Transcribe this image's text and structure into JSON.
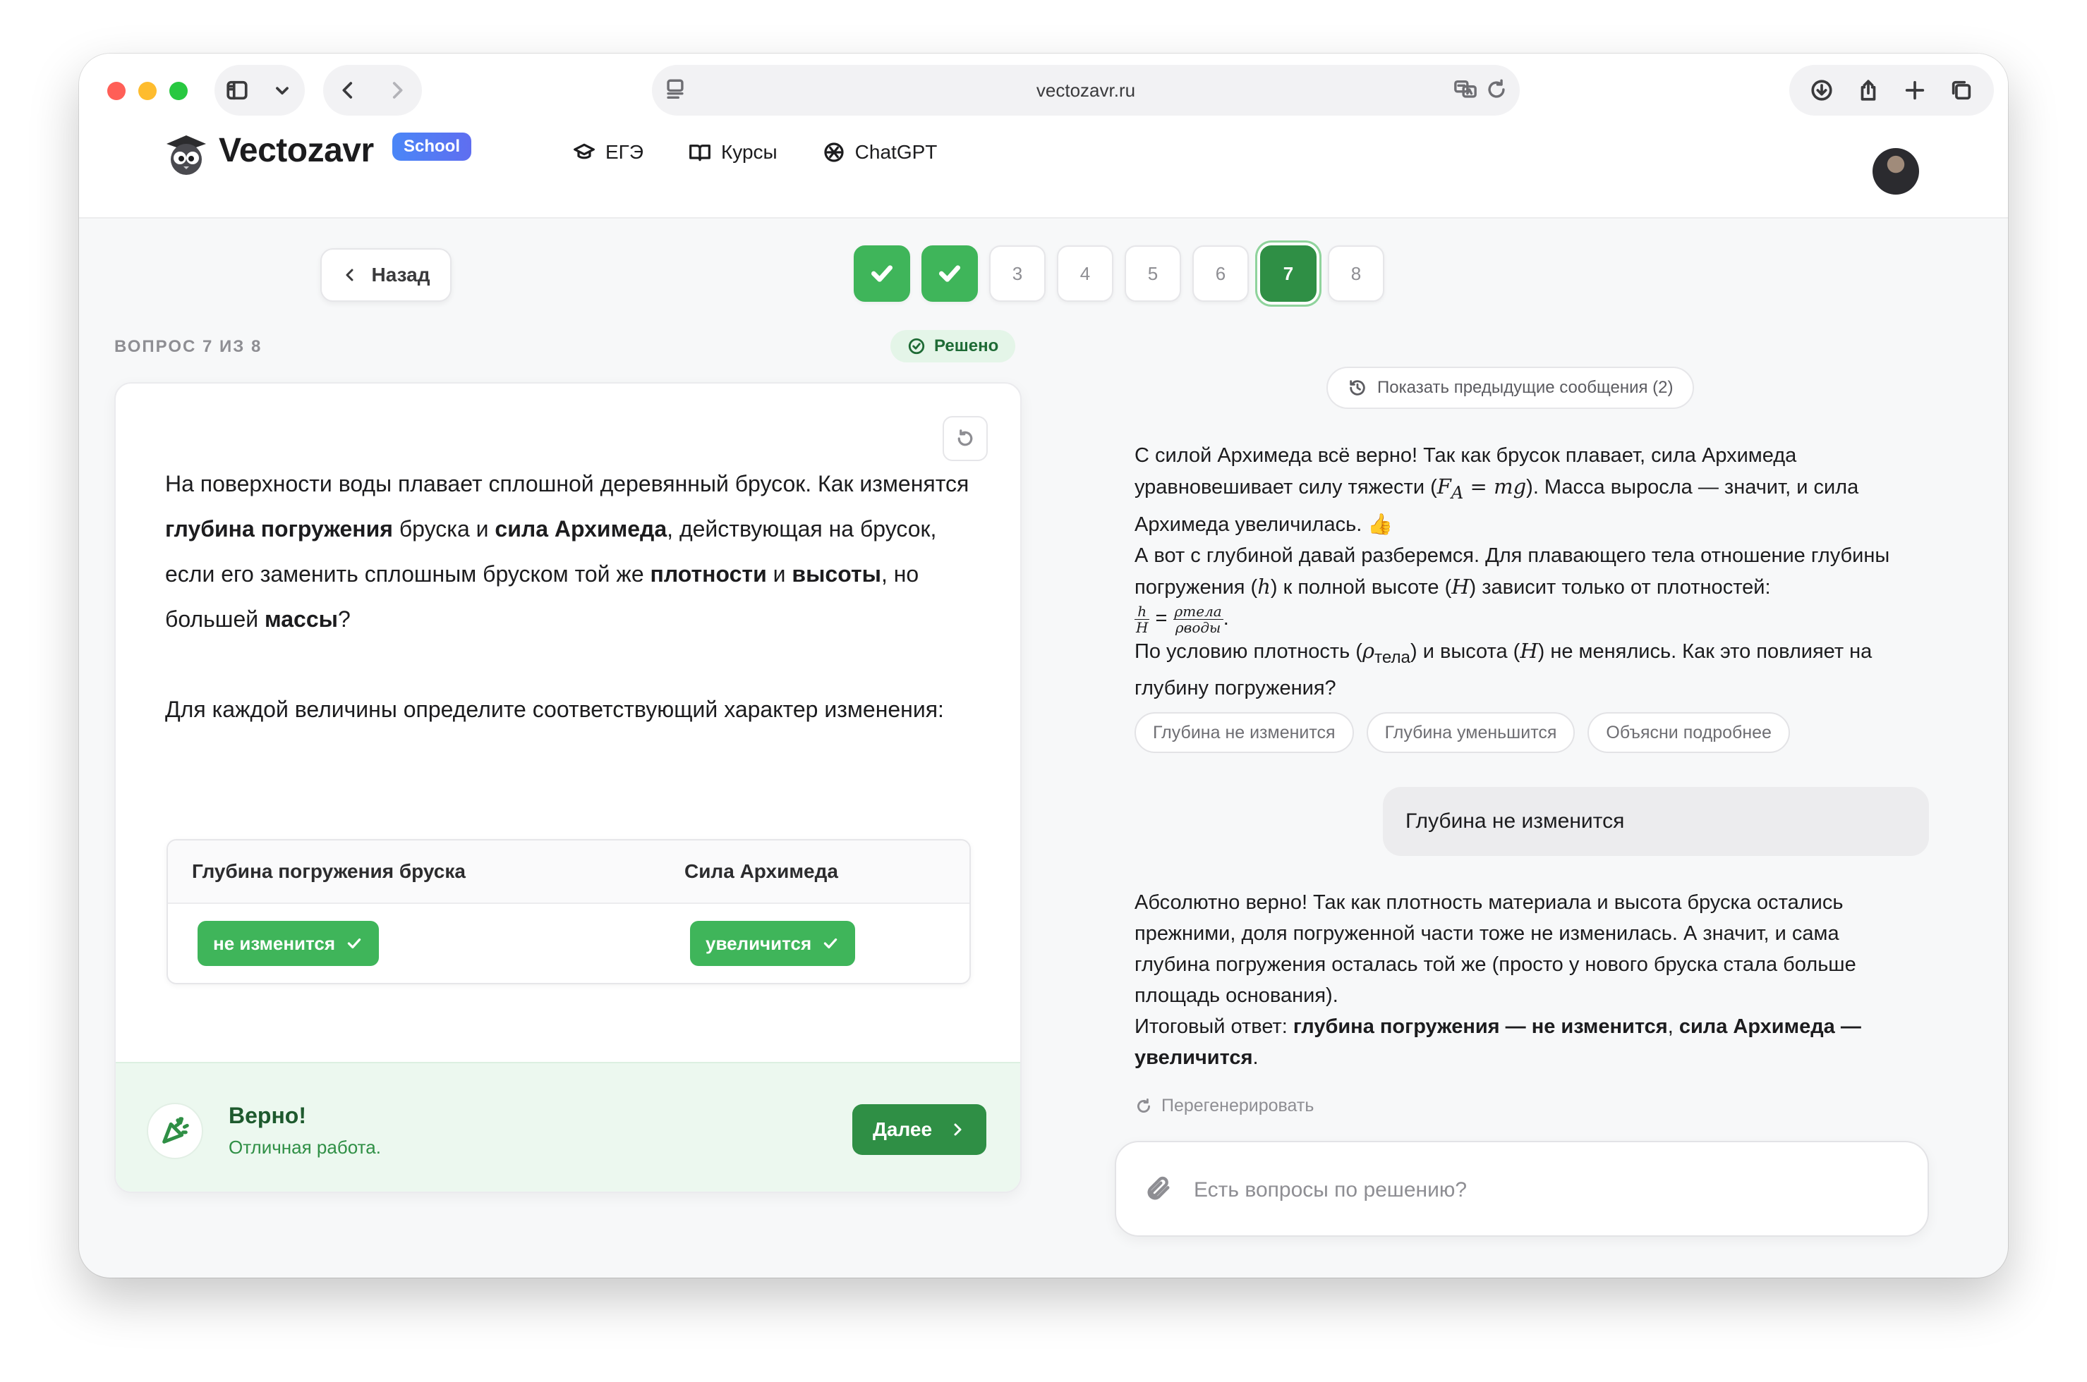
{
  "browser": {
    "url": "vectozavr.ru"
  },
  "site": {
    "logo_text": "Vectozavr",
    "badge": "School",
    "nav": [
      {
        "label": "ЕГЭ",
        "icon": "graduation-cap-icon"
      },
      {
        "label": "Курсы",
        "icon": "book-open-icon"
      },
      {
        "label": "ChatGPT",
        "icon": "openai-icon"
      }
    ]
  },
  "question_nav": {
    "back_label": "Назад",
    "items": [
      {
        "label": "1",
        "status": "done"
      },
      {
        "label": "2",
        "status": "done"
      },
      {
        "label": "3",
        "status": "pending"
      },
      {
        "label": "4",
        "status": "pending"
      },
      {
        "label": "5",
        "status": "pending"
      },
      {
        "label": "6",
        "status": "pending"
      },
      {
        "label": "7",
        "status": "current"
      },
      {
        "label": "8",
        "status": "pending"
      }
    ]
  },
  "question": {
    "counter": "ВОПРОС 7 ИЗ 8",
    "status": "Решено",
    "text_parts": {
      "p1": "На поверхности воды плавает сплошной деревянный брусок. Как изменятся ",
      "b1": "глубина погружения",
      "p2": " бруска и ",
      "b2": "сила Архимеда",
      "p3": ", действующая на брусок, если его заменить сплошным бруском той же ",
      "b3": "плотности",
      "p4": " и ",
      "b4": "высоты",
      "p5": ", но большей ",
      "b5": "массы",
      "p6": "?"
    },
    "instruction": "Для каждой величины определите соответствующий характер изменения:",
    "table": {
      "headers": [
        "Глубина погружения бруска",
        "Сила Архимеда"
      ],
      "answers": [
        "не изменится",
        "увеличится"
      ]
    },
    "feedback": {
      "title": "Верно!",
      "subtitle": "Отличная работа.",
      "next_label": "Далее"
    }
  },
  "chat": {
    "show_previous": "Показать предыдущие сообщения (2)",
    "assistant_msg_1": {
      "l1": "С силой Архимеда всё верно! Так как брусок плавает, сила Архимеда уравновешивает силу тяжести (",
      "m1": "F",
      "m1sub": "A",
      "m1b": " = mg",
      "l2": "). Масса выросла — значит, и сила Архимеда увеличилась. ",
      "emoji": "👍",
      "l3": "А вот с глубиной давай разберемся. Для плавающего тела отношение глубины погружения (",
      "m2": "h",
      "l4": ") к полной высоте (",
      "m3": "H",
      "l5": ") зависит только от плотностей: ",
      "frac1_num": "h",
      "frac1_den": "H",
      "eq": " = ",
      "frac2_num": "ρтела",
      "frac2_den": "ρводы",
      "dot": ".",
      "l6": "По условию плотность (",
      "m4": "ρ",
      "m4sub": "тела",
      "l7": ") и высота (",
      "m5": "H",
      "l8": ") не менялись. Как это повлияет на глубину погружения?"
    },
    "suggestions": [
      "Глубина не изменится",
      "Глубина уменьшится",
      "Объясни подробнее"
    ],
    "user_msg": "Глубина не изменится",
    "assistant_msg_2": {
      "p1": "Абсолютно верно! Так как плотность материала и высота бруска остались прежними, доля погруженной части тоже не изменилась. А значит, и сама глубина погружения осталась той же (просто у нового бруска стала больше площадь основания).",
      "p2": "Итоговый ответ: ",
      "b1": "глубина погружения — не изменится",
      "p3": ", ",
      "b2": "сила Архимеда — увеличится",
      "p4": "."
    },
    "regenerate": "Перегенерировать",
    "input_placeholder": "Есть вопросы по решению?"
  }
}
